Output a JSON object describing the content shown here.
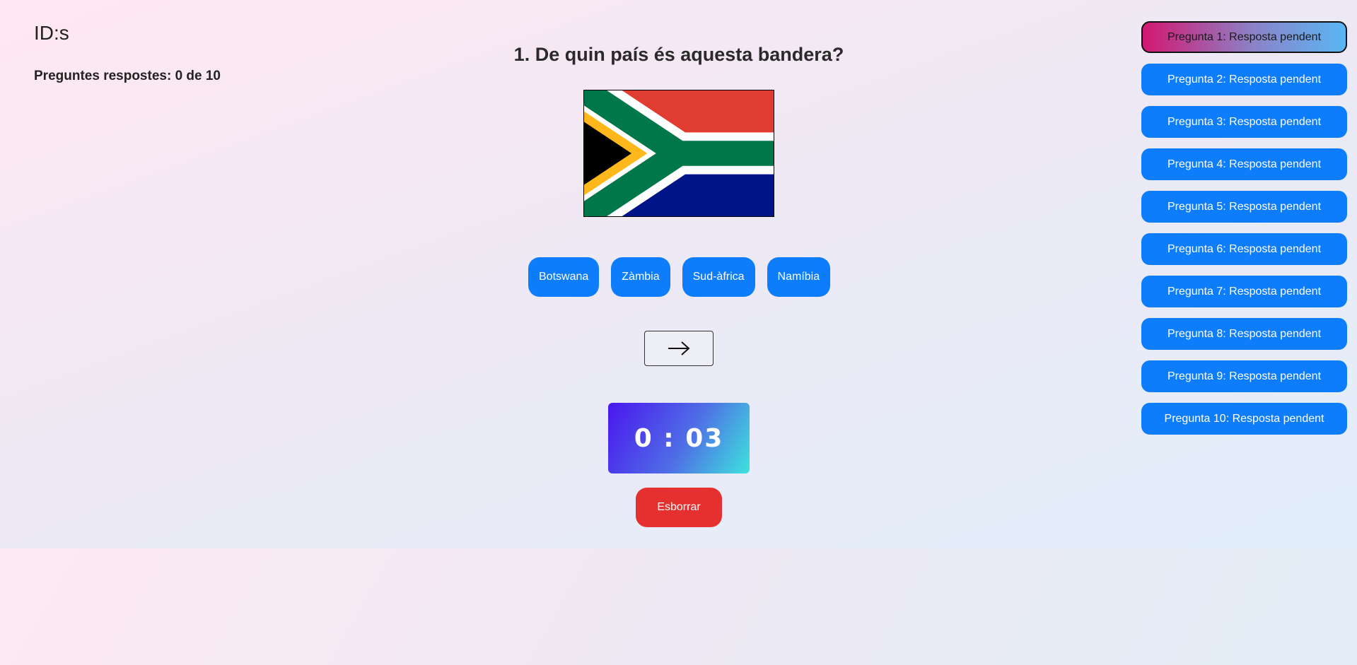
{
  "header": {
    "id_label": "ID:s",
    "progress": "Preguntes respostes: 0 de 10"
  },
  "question": {
    "title": "1. De quin país és aquesta bandera?",
    "flag_icon": "south-africa-flag"
  },
  "answers": [
    "Botswana",
    "Zàmbia",
    "Sud-àfrica",
    "Namíbia"
  ],
  "next_button": {
    "icon": "arrow-right-icon"
  },
  "timer": {
    "value": "0 : 03"
  },
  "clear_button": {
    "label": "Esborrar"
  },
  "sidebar": {
    "items": [
      {
        "label": "Pregunta 1: Resposta pendent",
        "active": true
      },
      {
        "label": "Pregunta 2: Resposta pendent",
        "active": false
      },
      {
        "label": "Pregunta 3: Resposta pendent",
        "active": false
      },
      {
        "label": "Pregunta 4: Resposta pendent",
        "active": false
      },
      {
        "label": "Pregunta 5: Resposta pendent",
        "active": false
      },
      {
        "label": "Pregunta 6: Resposta pendent",
        "active": false
      },
      {
        "label": "Pregunta 7: Resposta pendent",
        "active": false
      },
      {
        "label": "Pregunta 8: Resposta pendent",
        "active": false
      },
      {
        "label": "Pregunta 9: Resposta pendent",
        "active": false
      },
      {
        "label": "Pregunta 10: Resposta pendent",
        "active": false
      }
    ]
  },
  "colors": {
    "button_blue": "#0d7dfb",
    "clear_red": "#e4302f",
    "flag_red": "#e03c31",
    "flag_green": "#007749",
    "flag_blue": "#001489",
    "flag_gold": "#ffb81c",
    "flag_black": "#000000",
    "flag_white": "#ffffff"
  }
}
